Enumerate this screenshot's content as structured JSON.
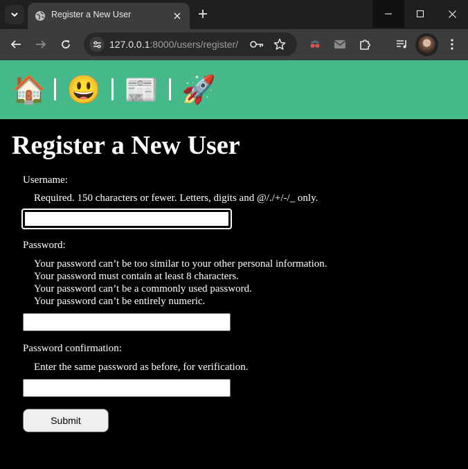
{
  "browser": {
    "tab_title": "Register a New User",
    "url_host": "127.0.0.1",
    "url_rest": ":8000/users/register/"
  },
  "nav": {
    "items": [
      {
        "icon": "🏠",
        "name": "home-icon"
      },
      {
        "icon": "😃",
        "name": "smiley-icon"
      },
      {
        "icon": "📰",
        "name": "newspaper-icon"
      },
      {
        "icon": "🚀",
        "name": "rocket-icon"
      }
    ],
    "background": "#46b98a"
  },
  "form": {
    "title": "Register a New User",
    "username_label": "Username:",
    "username_help": "Required. 150 characters or fewer. Letters, digits and @/./+/-/_ only.",
    "username_value": "",
    "password_label": "Password:",
    "password_help": [
      "Your password can’t be too similar to your other personal information.",
      "Your password must contain at least 8 characters.",
      "Your password can’t be a commonly used password.",
      "Your password can’t be entirely numeric."
    ],
    "password_value": "",
    "confirm_label": "Password confirmation:",
    "confirm_help": "Enter the same password as before, for verification.",
    "confirm_value": "",
    "submit_label": "Submit"
  }
}
